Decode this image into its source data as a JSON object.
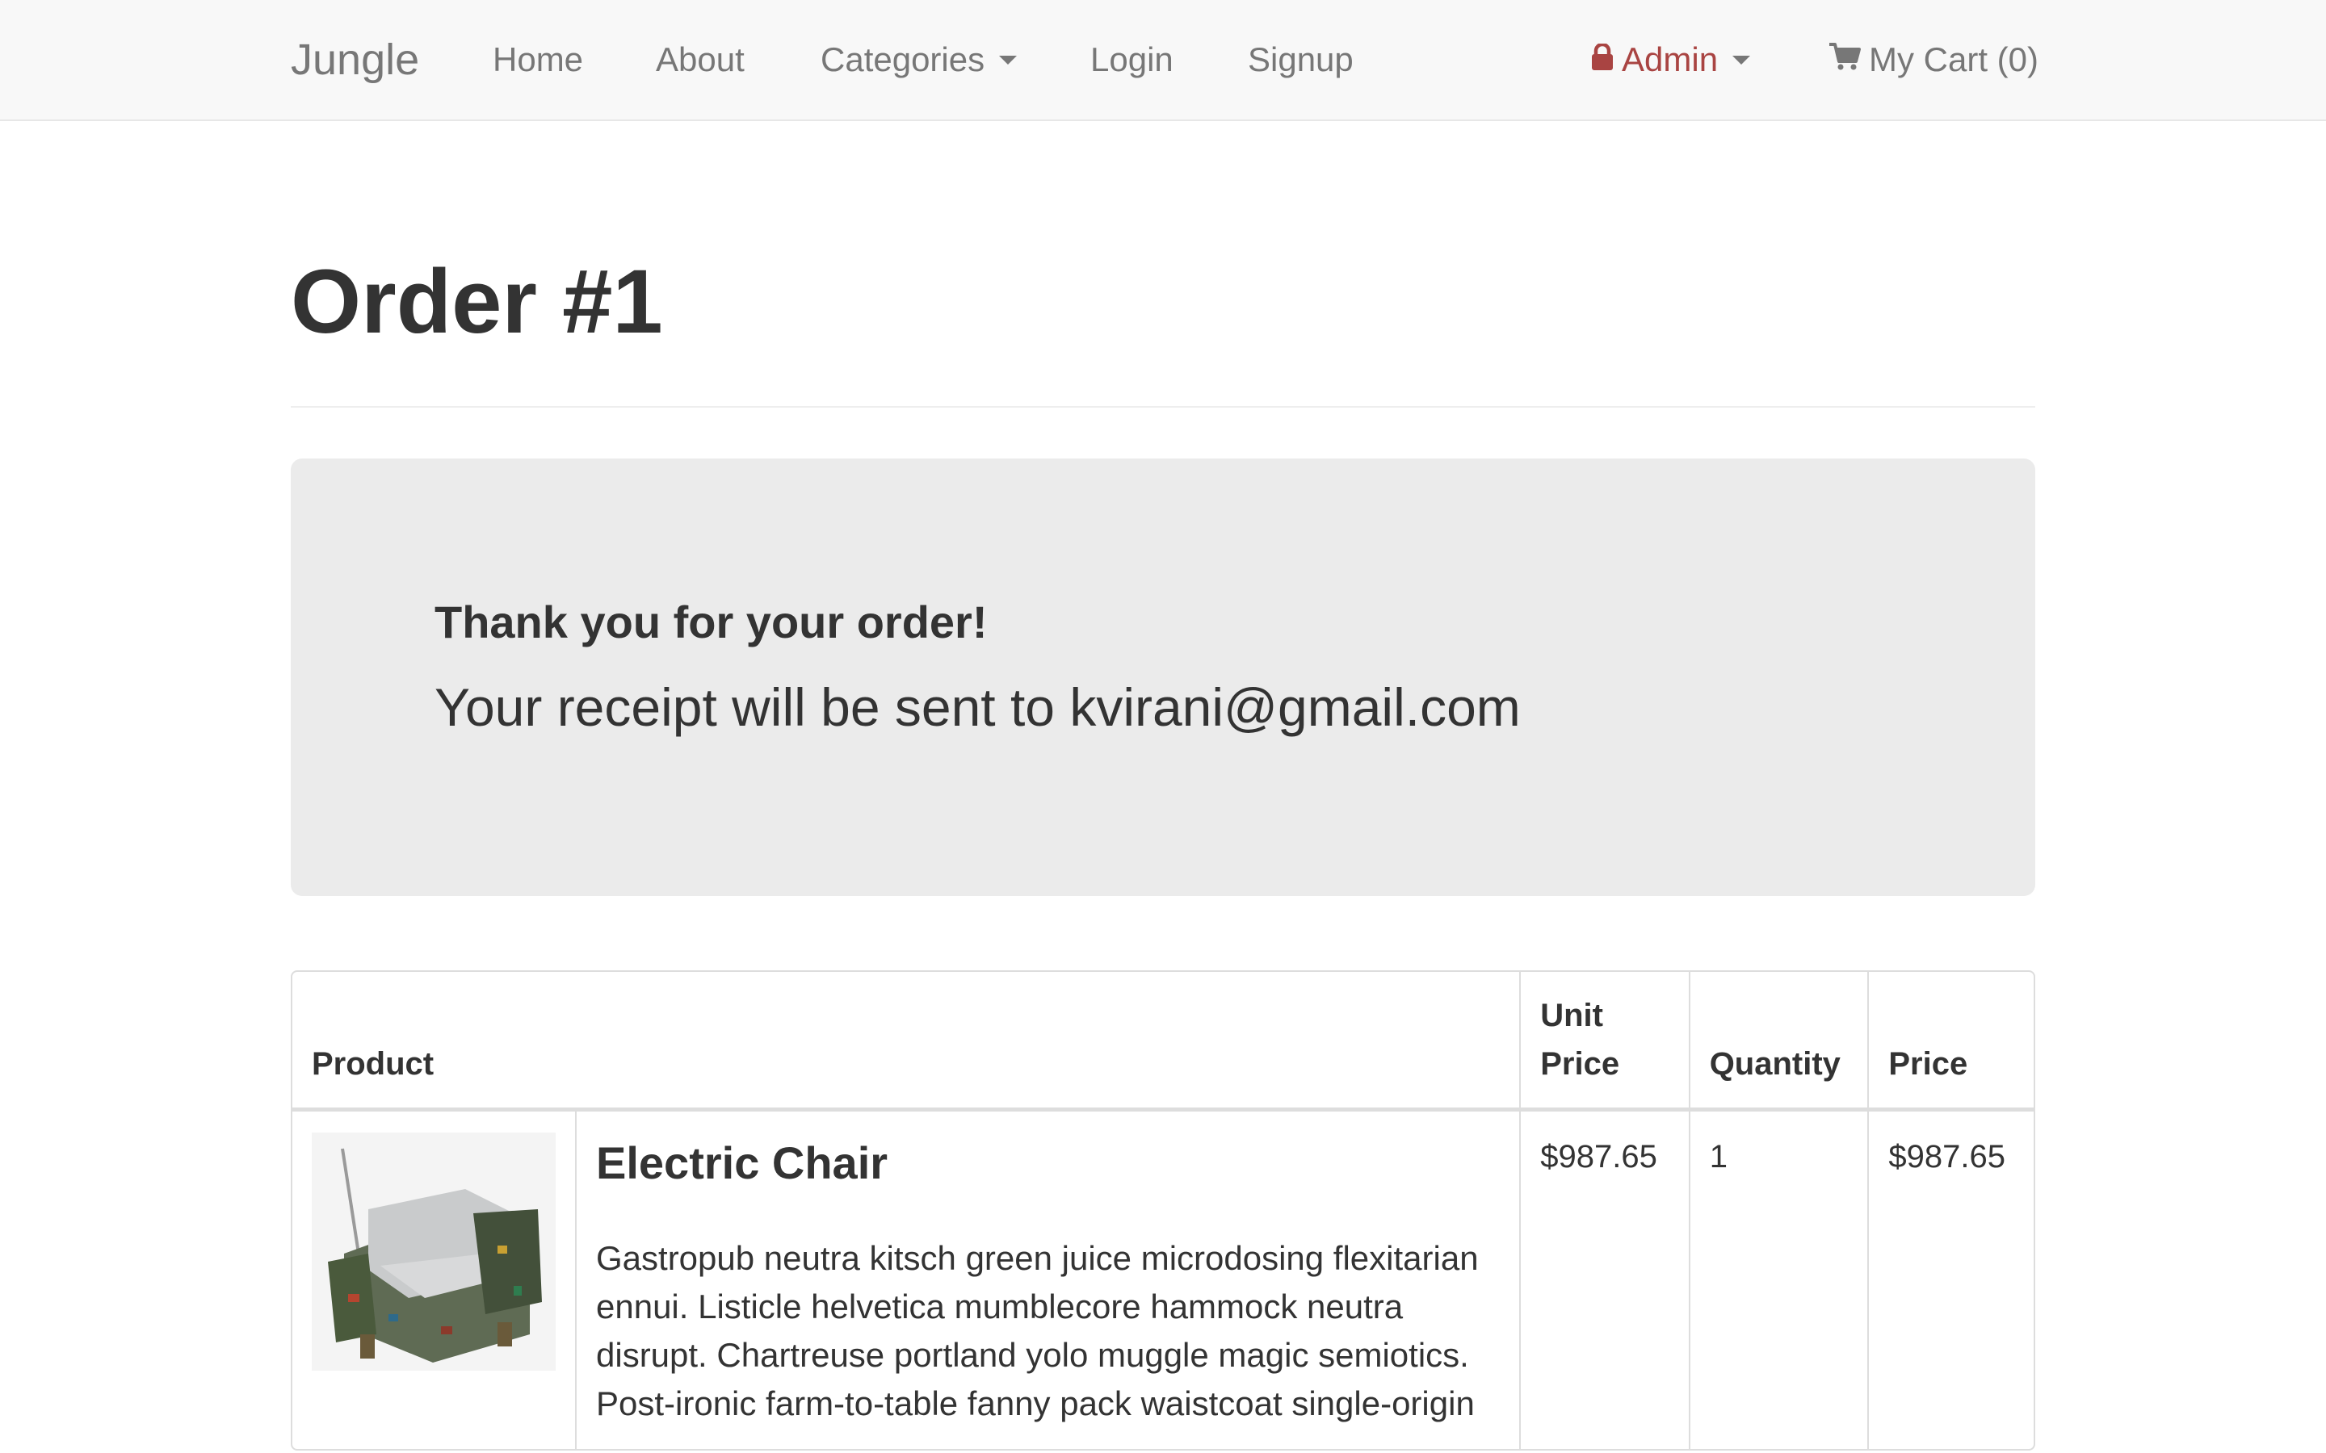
{
  "navbar": {
    "brand": "Jungle",
    "links": {
      "home": "Home",
      "about": "About",
      "categories": "Categories",
      "login": "Login",
      "signup": "Signup"
    },
    "admin_label": "Admin",
    "admin_icon": "lock-icon",
    "admin_color": "#a94442",
    "cart_label": "My Cart (0)",
    "cart_icon": "shopping-cart-icon"
  },
  "page": {
    "title": "Order #1"
  },
  "jumbotron": {
    "heading": "Thank you for your order!",
    "message": "Your receipt will be sent to kvirani@gmail.com"
  },
  "order_table": {
    "headers": {
      "product": "Product",
      "unit_price_line1": "Unit",
      "unit_price_line2": "Price",
      "quantity": "Quantity",
      "price": "Price"
    },
    "rows": [
      {
        "image_alt": "electric-chair-image",
        "name": "Electric Chair",
        "description": "Gastropub neutra kitsch green juice microdosing flexitarian ennui. Listicle helvetica mumblecore hammock neutra disrupt. Chartreuse portland yolo muggle magic semiotics. Post-ironic farm-to-table fanny pack waistcoat single-origin",
        "unit_price": "$987.65",
        "quantity": "1",
        "price": "$987.65"
      }
    ]
  }
}
